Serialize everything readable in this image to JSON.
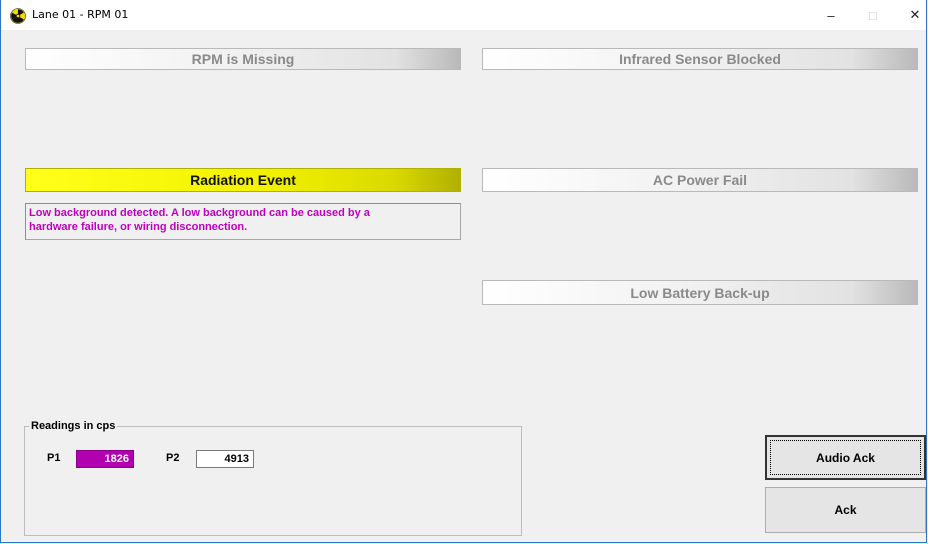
{
  "window": {
    "title": "Lane 01 - RPM 01",
    "icon": "radiation-icon",
    "controls": {
      "minimize": "–",
      "maximize": "□",
      "close": "✕"
    }
  },
  "alarms": {
    "rpm_missing": "RPM is Missing",
    "infrared_blocked": "Infrared Sensor Blocked",
    "radiation_event": "Radiation Event",
    "ac_power_fail": "AC Power Fail",
    "low_battery": "Low Battery Back-up"
  },
  "message": {
    "line1": "Low background detected.  A low background can be caused by a",
    "line2": "hardware failure, or wiring disconnection."
  },
  "readings": {
    "legend": "Readings in cps",
    "p1_label": "P1",
    "p1_value": "1826",
    "p2_label": "P2",
    "p2_value": "4913"
  },
  "buttons": {
    "audio_ack": "Audio Ack",
    "ack": "Ack"
  },
  "colors": {
    "active_alarm": "#ffff00",
    "message_text": "#c000c0",
    "p1_highlight": "#b000b0",
    "window_border": "#2b77c6"
  }
}
